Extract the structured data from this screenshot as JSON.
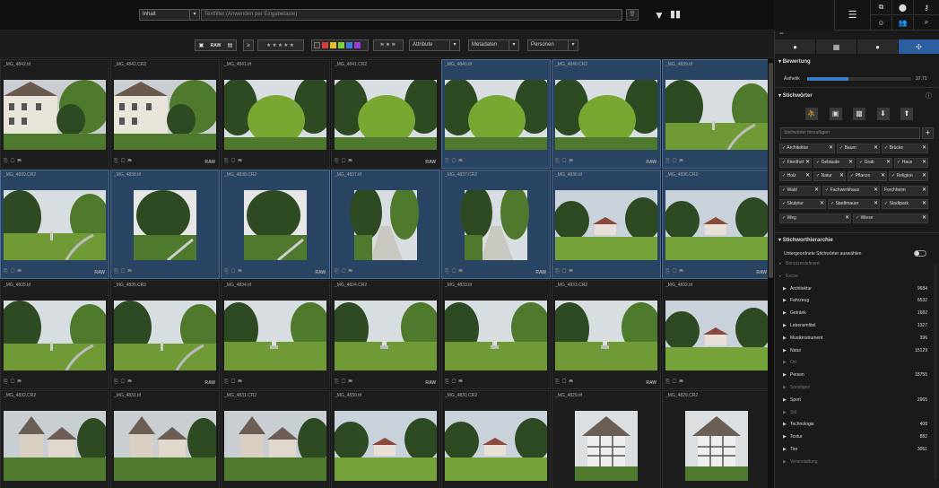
{
  "toolbar": {
    "scope": "Inhalt",
    "text_filter_placeholder": "Textfilter (Anwenden per Eingabetaste)"
  },
  "filters": {
    "format_labels": [
      "RAW"
    ],
    "rating_prefix": "≥",
    "colors": [
      "#d23b3b",
      "#e6c12a",
      "#7fcf38",
      "#3b7de0",
      "#9b3ce0"
    ],
    "attribute": "Attribute",
    "metadata": "Metadaten",
    "people": "Personen"
  },
  "grid": {
    "cells": [
      {
        "name": "_MG_4842.tif",
        "raw": false,
        "selected": false,
        "scene": "building"
      },
      {
        "name": "_MG_4842.CR2",
        "raw": true,
        "selected": false,
        "scene": "building"
      },
      {
        "name": "_MG_4841.tif",
        "raw": false,
        "selected": false,
        "scene": "bush"
      },
      {
        "name": "_MG_4841.CR2",
        "raw": true,
        "selected": false,
        "scene": "bush"
      },
      {
        "name": "_MG_4840.tif",
        "raw": false,
        "selected": true,
        "scene": "bush"
      },
      {
        "name": "_MG_4840.CR2",
        "raw": true,
        "selected": true,
        "scene": "bush"
      },
      {
        "name": "_MG_4839.tif",
        "raw": false,
        "selected": true,
        "scene": "park"
      },
      {
        "name": "_MG_4839.CR2",
        "raw": true,
        "selected": true,
        "scene": "park"
      },
      {
        "name": "_MG_4838.tif",
        "raw": false,
        "selected": true,
        "scene": "portrait"
      },
      {
        "name": "_MG_4838.CR2",
        "raw": true,
        "selected": true,
        "scene": "portrait"
      },
      {
        "name": "_MG_4837.tif",
        "raw": false,
        "selected": true,
        "scene": "path"
      },
      {
        "name": "_MG_4837.CR2",
        "raw": true,
        "selected": true,
        "scene": "path"
      },
      {
        "name": "_MG_4836.tif",
        "raw": false,
        "selected": true,
        "scene": "field"
      },
      {
        "name": "_MG_4836.CR2",
        "raw": true,
        "selected": true,
        "scene": "field"
      },
      {
        "name": "_MG_4835.tif",
        "raw": false,
        "selected": false,
        "scene": "park"
      },
      {
        "name": "_MG_4835.CR2",
        "raw": true,
        "selected": false,
        "scene": "park"
      },
      {
        "name": "_MG_4834.tif",
        "raw": false,
        "selected": false,
        "scene": "statue"
      },
      {
        "name": "_MG_4834.CR2",
        "raw": true,
        "selected": false,
        "scene": "statue"
      },
      {
        "name": "_MG_4833.tif",
        "raw": false,
        "selected": false,
        "scene": "statue"
      },
      {
        "name": "_MG_4833.CR2",
        "raw": true,
        "selected": false,
        "scene": "statue"
      },
      {
        "name": "_MG_4832.tif",
        "raw": false,
        "selected": false,
        "scene": "field"
      },
      {
        "name": "_MG_4832.CR2",
        "raw": true,
        "selected": false,
        "scene": "village"
      },
      {
        "name": "_MG_4831.tif",
        "raw": false,
        "selected": false,
        "scene": "village"
      },
      {
        "name": "_MG_4831.CR2",
        "raw": true,
        "selected": false,
        "scene": "village"
      },
      {
        "name": "_MG_4830.tif",
        "raw": false,
        "selected": false,
        "scene": "field"
      },
      {
        "name": "_MG_4830.CR2",
        "raw": true,
        "selected": false,
        "scene": "field"
      },
      {
        "name": "_MG_4829.tif",
        "raw": false,
        "selected": false,
        "scene": "tower"
      },
      {
        "name": "_MG_4829.CR2",
        "raw": true,
        "selected": false,
        "scene": "tower"
      }
    ]
  },
  "panel": {
    "rating": {
      "title": "Bewertung",
      "aesthetic_label": "Ästhetik",
      "aesthetic_value": "37.71",
      "aesthetic_fraction": 0.4
    },
    "keywords": {
      "title": "Stichwörter",
      "add_placeholder": "Stichwörter hinzufügen",
      "items": [
        {
          "label": "Architektur",
          "checked": true
        },
        {
          "label": "Baum",
          "checked": true
        },
        {
          "label": "Brücke",
          "checked": true
        },
        {
          "label": "Friedhof",
          "checked": true
        },
        {
          "label": "Gebäude",
          "checked": true
        },
        {
          "label": "Grab",
          "checked": true
        },
        {
          "label": "Haus",
          "checked": true
        },
        {
          "label": "Holz",
          "checked": true
        },
        {
          "label": "Natur",
          "checked": true
        },
        {
          "label": "Pflanze",
          "checked": true
        },
        {
          "label": "Religion",
          "checked": true
        },
        {
          "label": "Wald",
          "checked": true
        },
        {
          "label": "Fachwerkhaus",
          "checked": true
        },
        {
          "label": "Forchheim",
          "checked": false
        },
        {
          "label": "Skulptur",
          "checked": true
        },
        {
          "label": "Stadtmauer",
          "checked": true
        },
        {
          "label": "Stadtpark",
          "checked": true
        },
        {
          "label": "Weg",
          "checked": true
        },
        {
          "label": "Wiese",
          "checked": true
        }
      ]
    },
    "hierarchy": {
      "title": "Stichworthierarchie",
      "toggle_label": "Untergeordnete Stichwörter auswählen",
      "items": [
        {
          "label": "Benutzerdefiniert",
          "count": "",
          "dim": true,
          "indent": 0
        },
        {
          "label": "Excire",
          "count": "",
          "dim": true,
          "indent": 0
        },
        {
          "label": "Architektur",
          "count": "9684",
          "dim": false,
          "indent": 1
        },
        {
          "label": "Fahrzeug",
          "count": "6532",
          "dim": false,
          "indent": 1
        },
        {
          "label": "Getränk",
          "count": "1682",
          "dim": false,
          "indent": 1
        },
        {
          "label": "Lebensmittel",
          "count": "1327",
          "dim": false,
          "indent": 1
        },
        {
          "label": "Musikinstrument",
          "count": "396",
          "dim": false,
          "indent": 1
        },
        {
          "label": "Natur",
          "count": "15129",
          "dim": false,
          "indent": 1
        },
        {
          "label": "Ort",
          "count": "",
          "dim": true,
          "indent": 1
        },
        {
          "label": "Person",
          "count": "18755",
          "dim": false,
          "indent": 1
        },
        {
          "label": "Sonstiges",
          "count": "",
          "dim": true,
          "indent": 1
        },
        {
          "label": "Sport",
          "count": "2965",
          "dim": false,
          "indent": 1
        },
        {
          "label": "Stil",
          "count": "",
          "dim": true,
          "indent": 1
        },
        {
          "label": "Technologie",
          "count": "408",
          "dim": false,
          "indent": 1
        },
        {
          "label": "Textur",
          "count": "882",
          "dim": false,
          "indent": 1
        },
        {
          "label": "Tier",
          "count": "3051",
          "dim": false,
          "indent": 1
        },
        {
          "label": "Veranstaltung",
          "count": "",
          "dim": true,
          "indent": 1
        }
      ]
    }
  }
}
